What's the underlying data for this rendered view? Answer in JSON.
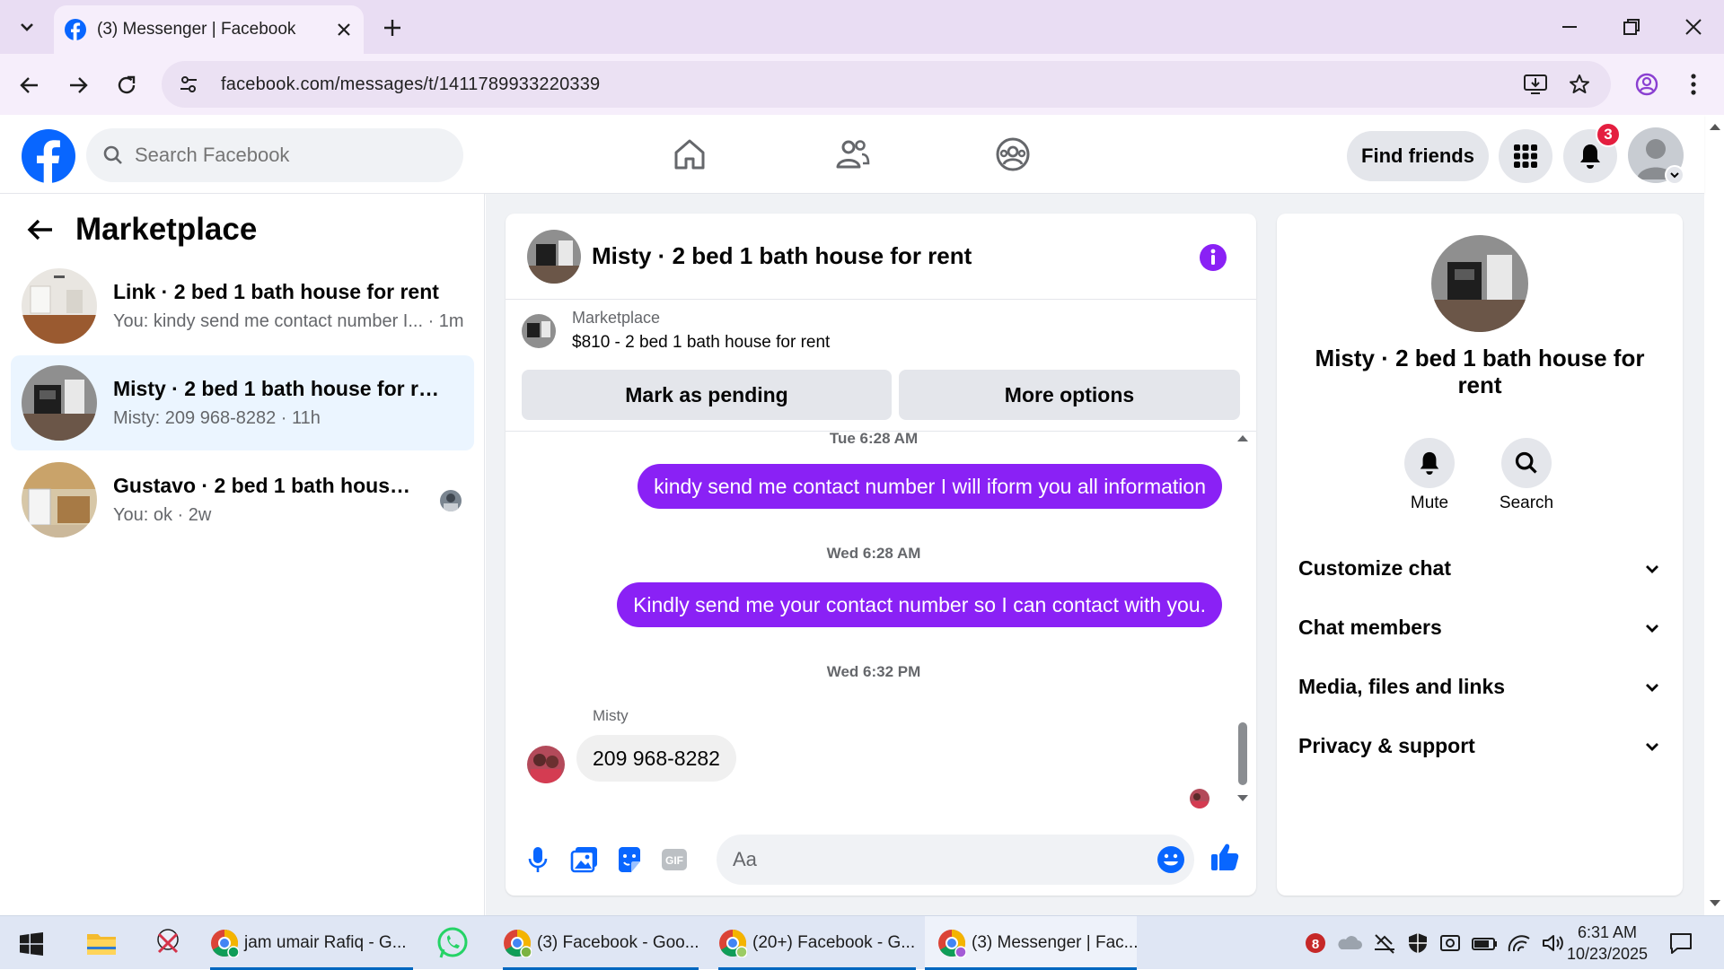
{
  "browser": {
    "tab_title": "(3) Messenger | Facebook",
    "url": "facebook.com/messages/t/1411789933220339"
  },
  "header": {
    "search_placeholder": "Search Facebook",
    "find_friends_label": "Find friends",
    "notification_count": "3",
    "brand_color": "#0866ff"
  },
  "sidebar": {
    "title": "Marketplace",
    "conversations": [
      {
        "name": "Link · 2 bed 1 bath house for rent",
        "preview": "You: kindy send me contact number I... · 1m",
        "active": false
      },
      {
        "name": "Misty · 2 bed 1 bath house for rent",
        "preview": "Misty: 209 968-8282 · 11h",
        "active": true
      },
      {
        "name": "Gustavo · 2 bed 1 bath house for...",
        "preview": "You: ok · 2w",
        "active": false
      }
    ]
  },
  "chat": {
    "title": "Misty · 2 bed 1 bath house for rent",
    "listing_label": "Marketplace",
    "listing_title": "$810 - 2 bed 1 bath house for rent",
    "mark_pending_label": "Mark as pending",
    "more_options_label": "More options",
    "messages": [
      {
        "type": "timestamp",
        "text": "Tue 6:28 AM"
      },
      {
        "type": "outgoing",
        "text": "kindy send me contact number I will iform you all information"
      },
      {
        "type": "timestamp",
        "text": "Wed 6:28 AM"
      },
      {
        "type": "outgoing",
        "text": "Kindly send me your contact number so I can contact with you."
      },
      {
        "type": "timestamp",
        "text": "Wed 6:32 PM"
      },
      {
        "type": "incoming",
        "sender": "Misty",
        "text": "209 968-8282"
      }
    ],
    "composer_placeholder": "Aa",
    "accent_color": "#8a21f5"
  },
  "info_panel": {
    "name": "Misty · 2 bed 1 bath house for rent",
    "mute_label": "Mute",
    "search_label": "Search",
    "sections": [
      "Customize chat",
      "Chat members",
      "Media, files and links",
      "Privacy & support"
    ]
  },
  "taskbar": {
    "apps": [
      {
        "label": "jam umair Rafiq - G..."
      },
      {
        "label": "(3) Facebook - Goo..."
      },
      {
        "label": "(20+) Facebook - G..."
      },
      {
        "label": "(3) Messenger | Fac..."
      }
    ],
    "time": "6:31 AM",
    "date": "10/23/2025"
  }
}
